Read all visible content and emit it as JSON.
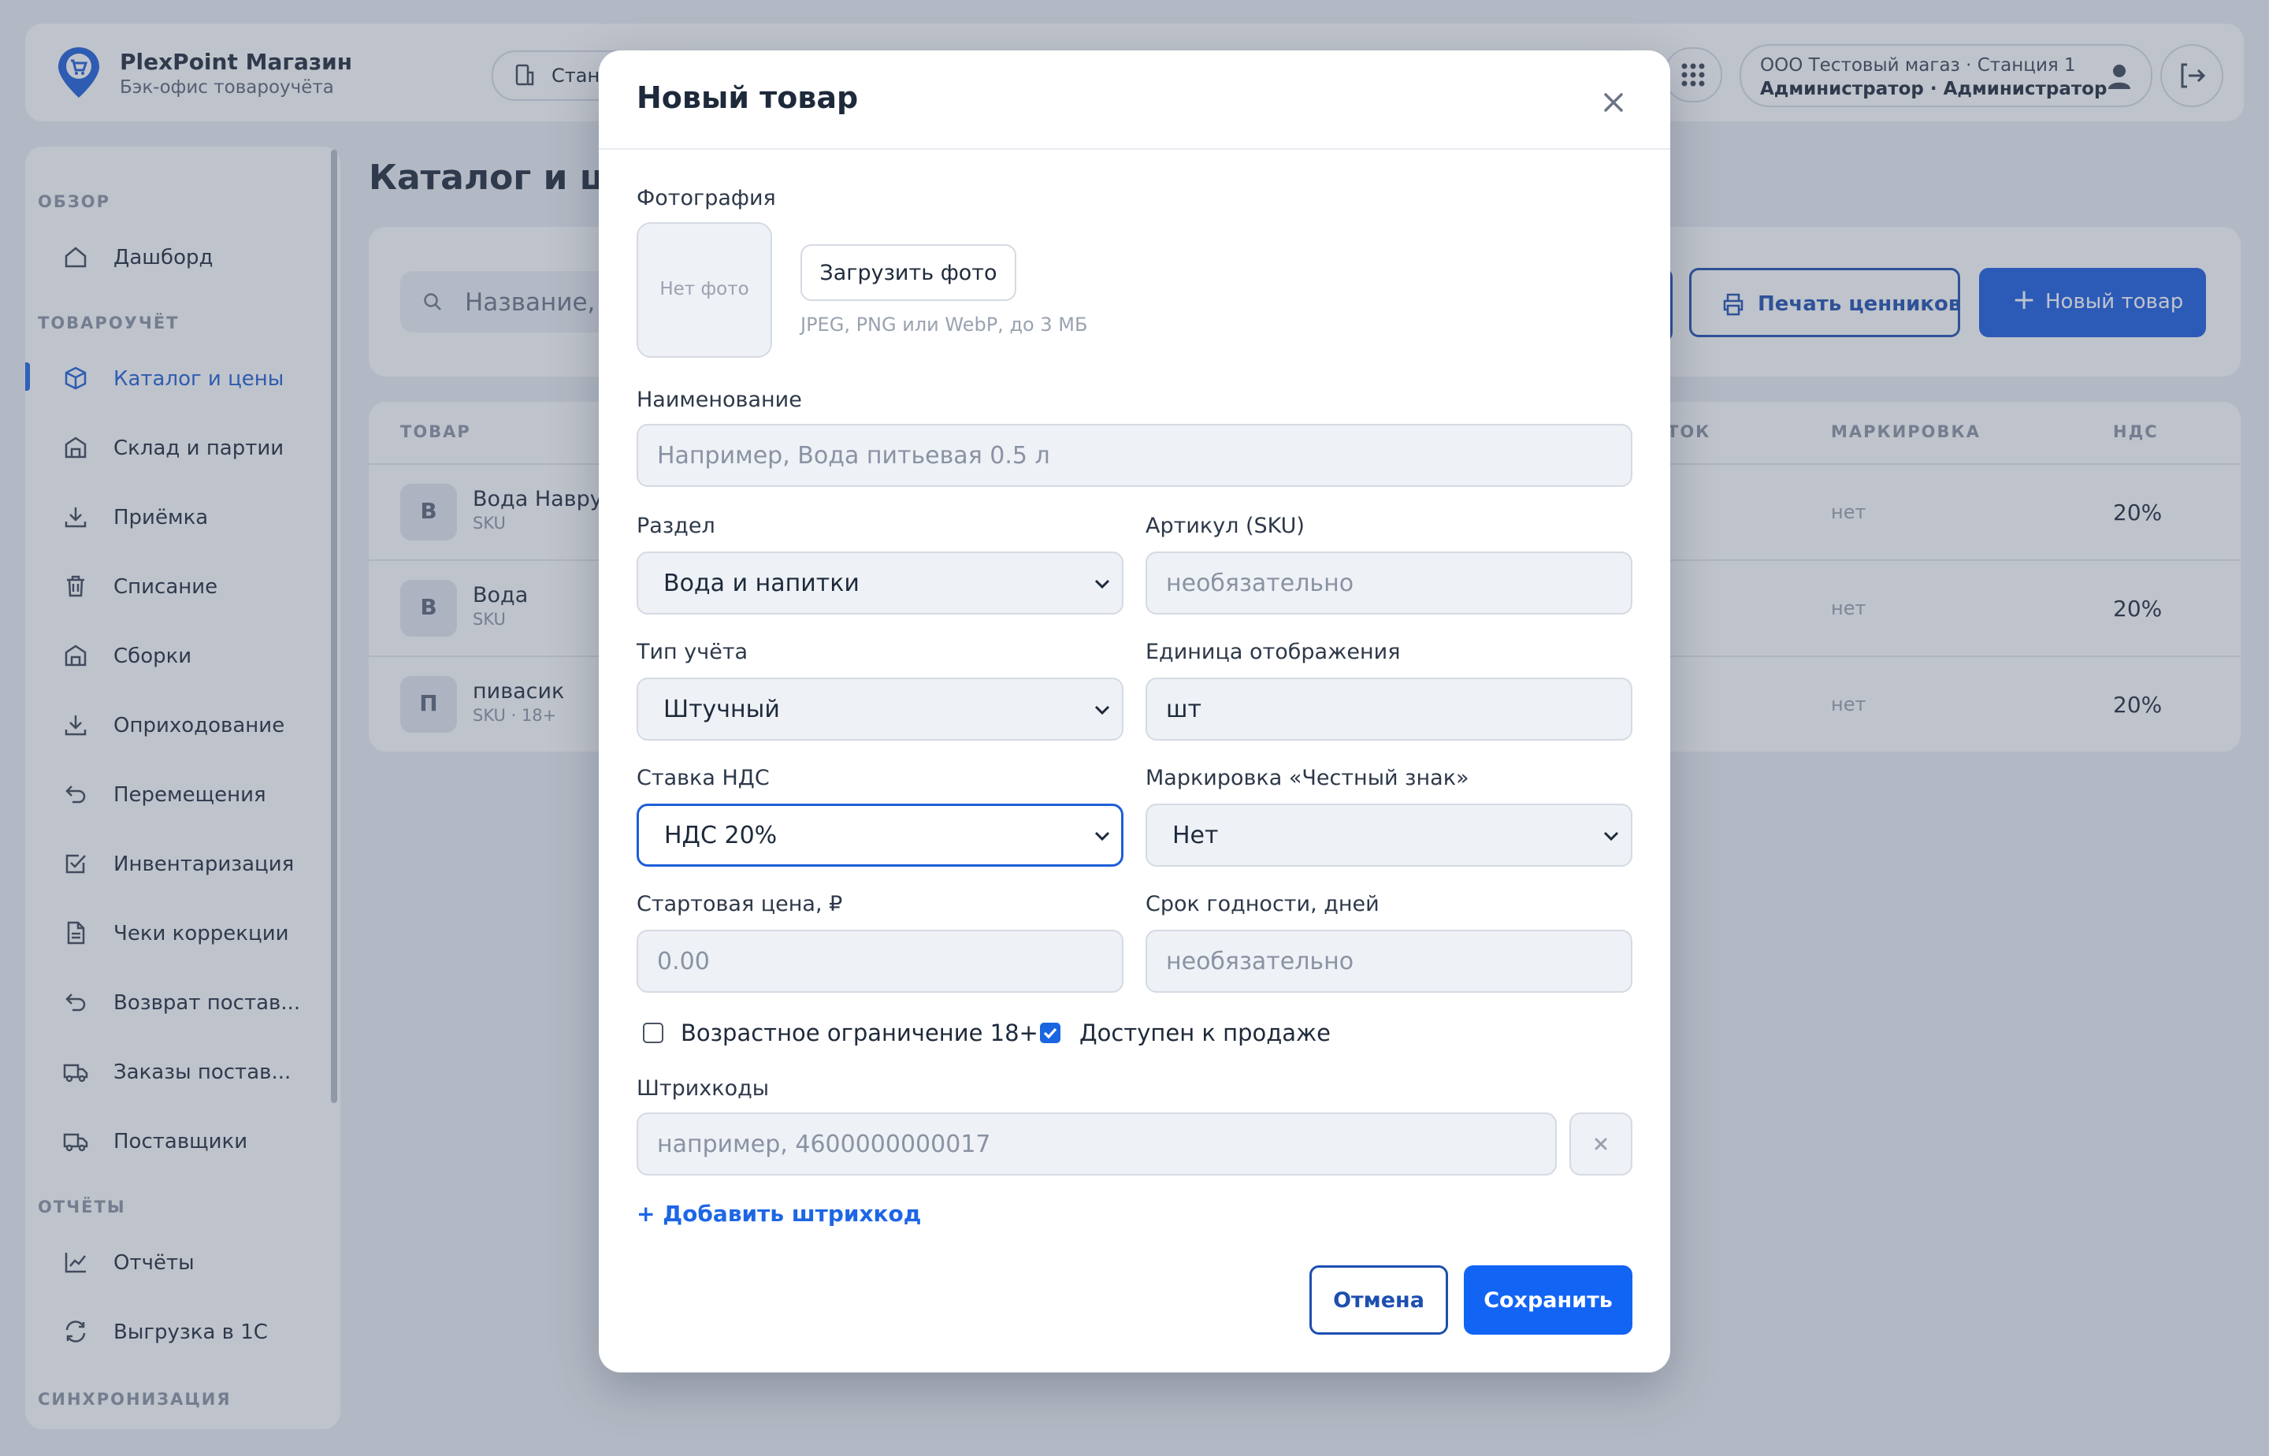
{
  "app": {
    "brand_title": "PlexPoint Магазин",
    "brand_subtitle": "Бэк-офис товароучёта",
    "station_chip": "Стан",
    "user_org_station": "ООО Тестовый магаз · Станция 1",
    "user_role": "Администратор · Администратор",
    "accent_color": "#1a5ce0"
  },
  "sidebar": {
    "sections": [
      {
        "title": "ОБЗОР"
      },
      {
        "title": "ТОВАРОУЧЁТ"
      },
      {
        "title": "ОТЧЁТЫ"
      },
      {
        "title": "СИНХРОНИЗАЦИЯ"
      }
    ],
    "items": [
      {
        "label": "Дашборд",
        "icon": "home-icon"
      },
      {
        "label": "Каталог и цены",
        "icon": "cube-icon",
        "active": true
      },
      {
        "label": "Склад и партии",
        "icon": "warehouse-icon"
      },
      {
        "label": "Приёмка",
        "icon": "download-icon"
      },
      {
        "label": "Списание",
        "icon": "trash-icon"
      },
      {
        "label": "Сборки",
        "icon": "warehouse-icon"
      },
      {
        "label": "Оприходование",
        "icon": "download-icon"
      },
      {
        "label": "Перемещения",
        "icon": "return-arrow-icon"
      },
      {
        "label": "Инвентаризация",
        "icon": "checkbox-icon"
      },
      {
        "label": "Чеки коррекции",
        "icon": "document-icon"
      },
      {
        "label": "Возврат постав...",
        "icon": "return-arrow-icon"
      },
      {
        "label": "Заказы постав...",
        "icon": "truck-icon"
      },
      {
        "label": "Поставщики",
        "icon": "truck-icon"
      },
      {
        "label": "Отчёты",
        "icon": "chart-line-icon"
      },
      {
        "label": "Выгрузка в 1С",
        "icon": "sync-icon"
      }
    ]
  },
  "page": {
    "title": "Каталог и цен",
    "search_placeholder": "Название,",
    "print_button": "Печать ценников",
    "new_button": "Новый товар",
    "columns": {
      "product": "ТОВАР",
      "stock_partial": "ТОК",
      "marking": "МАРКИРОВКА",
      "vat": "НДС"
    },
    "rows": [
      {
        "avatar": "В",
        "name": "Вода Наврузов",
        "sku": "SKU",
        "marking": "нет",
        "vat": "20%"
      },
      {
        "avatar": "В",
        "name": "Вода",
        "sku": "SKU",
        "marking": "нет",
        "vat": "20%"
      },
      {
        "avatar": "П",
        "name": "пивасик",
        "sku": "SKU · 18+",
        "marking": "нет",
        "vat": "20%"
      }
    ]
  },
  "modal": {
    "title": "Новый товар",
    "photo_label": "Фотография",
    "no_photo": "Нет фото",
    "upload_button": "Загрузить фото",
    "upload_hint": "JPEG, PNG или WebP, до 3 МБ",
    "name_label": "Наименование",
    "name_placeholder": "Например, Вода питьевая 0.5 л",
    "section_label": "Раздел",
    "section_value": "Вода и напитки",
    "sku_label": "Артикул (SKU)",
    "sku_placeholder": "необязательно",
    "accounting_label": "Тип учёта",
    "accounting_value": "Штучный",
    "unit_label": "Единица отображения",
    "unit_value": "шт",
    "vat_label": "Ставка НДС",
    "vat_value": "НДС 20%",
    "marking_label": "Маркировка «Честный знак»",
    "marking_value": "Нет",
    "price_label": "Стартовая цена, ₽",
    "price_placeholder": "0.00",
    "shelf_label": "Срок годности, дней",
    "shelf_placeholder": "необязательно",
    "age_checkbox_label": "Возрастное ограничение 18+",
    "age_checked": false,
    "available_checkbox_label": "Доступен к продаже",
    "available_checked": true,
    "barcodes_label": "Штрихкоды",
    "barcode_placeholder": "например, 4600000000017",
    "add_barcode": "+ Добавить штрихкод",
    "cancel_button": "Отмена",
    "save_button": "Сохранить"
  }
}
